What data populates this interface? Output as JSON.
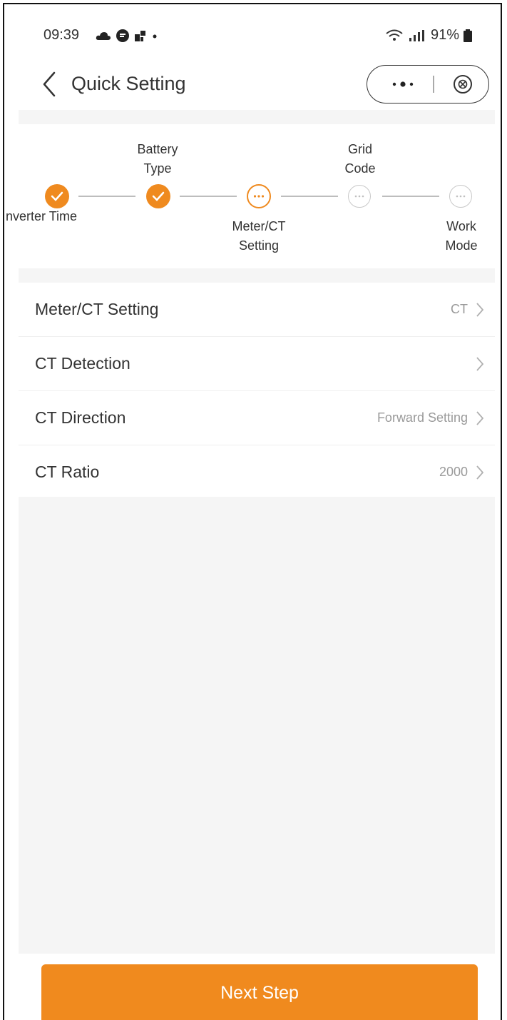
{
  "status_bar": {
    "time": "09:39",
    "battery": "91%",
    "icons": [
      "cloud-icon",
      "chat-icon",
      "grid-icon",
      "dot-icon",
      "wifi-icon",
      "signal-icon",
      "battery-icon"
    ]
  },
  "header": {
    "title": "Quick Setting"
  },
  "steps": [
    {
      "label": "nverter Time",
      "status": "done"
    },
    {
      "label": "Battery\nType",
      "status": "done"
    },
    {
      "label": "Meter/CT\nSetting",
      "status": "current"
    },
    {
      "label": "Grid\nCode",
      "status": "todo"
    },
    {
      "label": "Work\nMode",
      "status": "todo"
    }
  ],
  "settings": [
    {
      "label": "Meter/CT Setting",
      "value": "CT"
    },
    {
      "label": "CT Detection",
      "value": ""
    },
    {
      "label": "CT Direction",
      "value": "Forward Setting"
    },
    {
      "label": "CT Ratio",
      "value": "2000"
    }
  ],
  "footer": {
    "next_label": "Next Step"
  },
  "colors": {
    "accent": "#ef8a1f",
    "background": "#f5f5f5"
  }
}
